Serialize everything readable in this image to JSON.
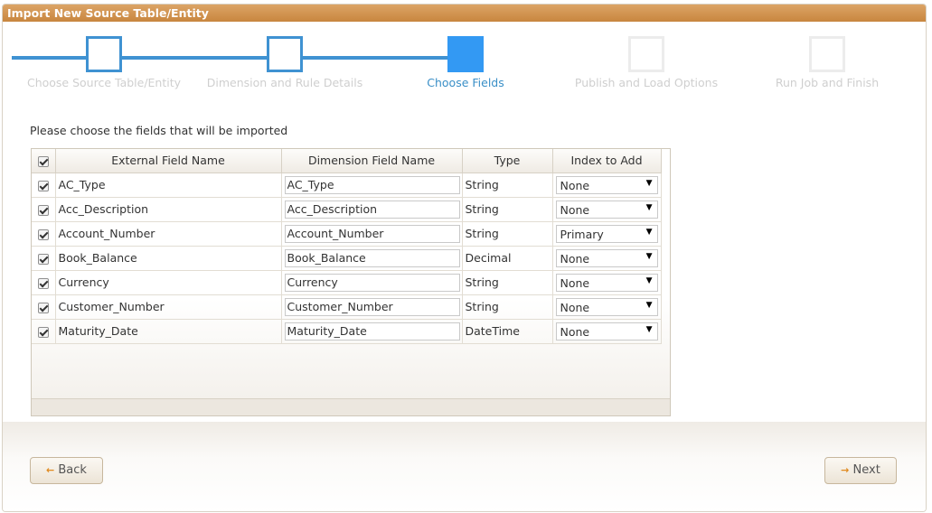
{
  "window": {
    "title": "Import New Source Table/Entity"
  },
  "wizard": {
    "steps": [
      {
        "label": "Choose Source Table/Entity",
        "state": "done"
      },
      {
        "label": "Dimension and Rule Details",
        "state": "done"
      },
      {
        "label": "Choose Fields",
        "state": "current"
      },
      {
        "label": "Publish and Load Options",
        "state": "future"
      },
      {
        "label": "Run Job and Finish",
        "state": "future"
      }
    ]
  },
  "content": {
    "instructions": "Please choose the fields that will be imported"
  },
  "grid": {
    "columns": [
      "External Field Name",
      "Dimension Field Name",
      "Type",
      "Index to Add"
    ],
    "rows": [
      {
        "external": "AC_Type",
        "dimension": "AC_Type",
        "type": "String",
        "index": "None"
      },
      {
        "external": "Acc_Description",
        "dimension": "Acc_Description",
        "type": "String",
        "index": "None"
      },
      {
        "external": "Account_Number",
        "dimension": "Account_Number",
        "type": "String",
        "index": "Primary"
      },
      {
        "external": "Book_Balance",
        "dimension": "Book_Balance",
        "type": "Decimal",
        "index": "None"
      },
      {
        "external": "Currency",
        "dimension": "Currency",
        "type": "String",
        "index": "None"
      },
      {
        "external": "Customer_Number",
        "dimension": "Customer_Number",
        "type": "String",
        "index": "None"
      },
      {
        "external": "Maturity_Date",
        "dimension": "Maturity_Date",
        "type": "DateTime",
        "index": "None"
      }
    ]
  },
  "buttons": {
    "back": "Back",
    "next": "Next"
  },
  "colors": {
    "title_bar": "#c8863f",
    "step_active": "#3399f3",
    "step_future": "#ececec",
    "accent_arrow": "#e08a1f"
  },
  "icons": {
    "check": "checkmark-icon",
    "dropdown": "caret-down-icon",
    "back": "arrow-left-icon",
    "next": "arrow-right-icon"
  }
}
